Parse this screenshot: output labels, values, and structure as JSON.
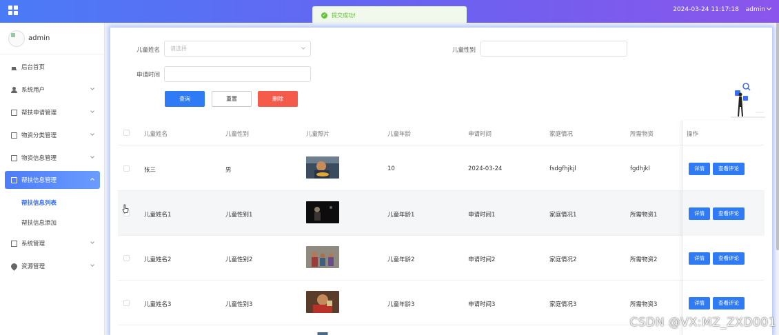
{
  "header": {
    "datetime": "2024-03-24 11:17:18",
    "user": "admin"
  },
  "toast": {
    "message": "提交成功!",
    "type": "success",
    "color": "#67c23a"
  },
  "sidebar": {
    "user_name": "admin",
    "items": [
      {
        "label": "后台首页",
        "icon": "home-icon"
      },
      {
        "label": "系统用户",
        "icon": "user-icon"
      },
      {
        "label": "帮扶申请管理",
        "icon": "document-icon"
      },
      {
        "label": "物资分类管理",
        "icon": "document-icon"
      },
      {
        "label": "物资信息管理",
        "icon": "document-icon"
      },
      {
        "label": "帮扶信息管理",
        "icon": "document-icon",
        "active": true
      },
      {
        "label": "系统管理",
        "icon": "image-icon"
      },
      {
        "label": "资源管理",
        "icon": "location-pin-icon"
      }
    ],
    "submenu": [
      {
        "label": "帮扶信息列表",
        "active": true
      },
      {
        "label": "帮扶信息添加"
      }
    ]
  },
  "search_form": {
    "child_name_label": "儿童姓名",
    "child_name_placeholder": "请选择",
    "child_gender_label": "儿童性别",
    "apply_time_label": "申请时间",
    "query_button": "查询",
    "reset_button": "重置",
    "delete_button": "删除"
  },
  "table": {
    "columns": [
      "儿童姓名",
      "儿童性别",
      "儿童照片",
      "儿童年龄",
      "申请时间",
      "家庭情况",
      "所需物资",
      "操作"
    ],
    "rows": [
      {
        "name": "张三",
        "gender": "男",
        "photo": "child-photo-1",
        "age": "10",
        "time": "2024-03-24",
        "family": "fsdgfhjkjl",
        "supplies": "fgdhjkl"
      },
      {
        "name": "儿童姓名1",
        "gender": "儿童性别1",
        "photo": "child-photo-2",
        "age": "儿童年龄1",
        "time": "申请时间1",
        "family": "家庭情况1",
        "supplies": "所需物资1"
      },
      {
        "name": "儿童姓名2",
        "gender": "儿童性别2",
        "photo": "child-photo-3",
        "age": "儿童年龄2",
        "time": "申请时间2",
        "family": "家庭情况2",
        "supplies": "所需物资2"
      },
      {
        "name": "儿童姓名3",
        "gender": "儿童性别3",
        "photo": "child-photo-4",
        "age": "儿童年龄3",
        "time": "申请时间3",
        "family": "家庭情况3",
        "supplies": "所需物资3"
      }
    ],
    "detail_button": "详情",
    "comment_button": "查看评论"
  },
  "watermark": "CSDN @VX:MZ_ZXD001",
  "colors": {
    "primary": "#2f7bf5",
    "danger": "#f45b4b",
    "header_start": "#4a7bf7",
    "header_end": "#8b55ec"
  }
}
